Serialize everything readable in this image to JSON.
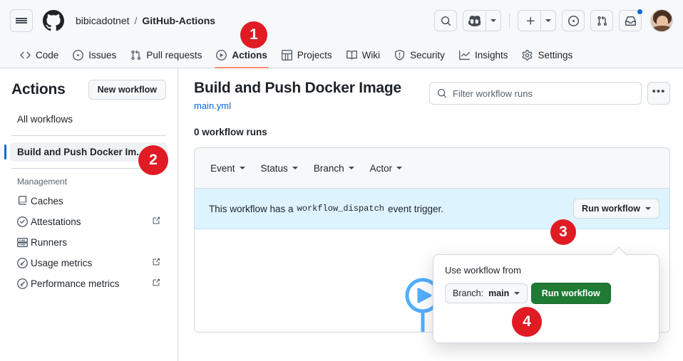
{
  "header": {
    "menu_icon": "hamburger-icon",
    "logo_icon": "github-logo-icon",
    "owner": "bibicadotnet",
    "separator": "/",
    "repo": "GitHub-Actions",
    "actions": [
      {
        "name": "search-button",
        "icon": "search-icon"
      },
      {
        "name": "copilot-button",
        "icon": "copilot-icon"
      },
      {
        "name": "copilot-caret",
        "icon": "chevron-down-icon"
      },
      {
        "name": "create-new-button",
        "icon": "plus-icon"
      },
      {
        "name": "create-new-caret",
        "icon": "chevron-down-icon"
      },
      {
        "name": "issues-button",
        "icon": "issue-opened-icon"
      },
      {
        "name": "pull-requests-button",
        "icon": "git-pull-request-icon"
      },
      {
        "name": "notifications-button",
        "icon": "inbox-icon"
      },
      {
        "name": "avatar-button",
        "icon": "avatar"
      }
    ]
  },
  "repo_nav": {
    "tabs": [
      {
        "label": "Code",
        "icon": "code-icon",
        "active": false
      },
      {
        "label": "Issues",
        "icon": "issue-opened-icon",
        "active": false
      },
      {
        "label": "Pull requests",
        "icon": "git-pull-request-icon",
        "active": false
      },
      {
        "label": "Actions",
        "icon": "play-circle-icon",
        "active": true
      },
      {
        "label": "Projects",
        "icon": "table-icon",
        "active": false
      },
      {
        "label": "Wiki",
        "icon": "book-icon",
        "active": false
      },
      {
        "label": "Security",
        "icon": "shield-icon",
        "active": false
      },
      {
        "label": "Insights",
        "icon": "graph-icon",
        "active": false
      },
      {
        "label": "Settings",
        "icon": "gear-icon",
        "active": false
      }
    ]
  },
  "sidebar": {
    "title": "Actions",
    "new_workflow_label": "New workflow",
    "all_workflows_label": "All workflows",
    "selected_workflow": "Build and Push Docker Im..",
    "management_title": "Management",
    "management_items": [
      {
        "label": "Caches",
        "icon": "cache-icon",
        "external": false
      },
      {
        "label": "Attestations",
        "icon": "verified-check-icon",
        "external": true
      },
      {
        "label": "Runners",
        "icon": "server-icon",
        "external": false
      },
      {
        "label": "Usage metrics",
        "icon": "meter-icon",
        "external": true
      },
      {
        "label": "Performance metrics",
        "icon": "meter-icon",
        "external": true
      }
    ]
  },
  "main": {
    "workflow_title": "Build and Push Docker Image",
    "workflow_file": "main.yml",
    "filter_placeholder": "Filter workflow runs",
    "filter_value": "",
    "search_icon": "search-icon",
    "kebab_label": "•••",
    "runs_count": "0 workflow runs",
    "filters": [
      {
        "label": "Event",
        "icon": "chevron-down-icon"
      },
      {
        "label": "Status",
        "icon": "chevron-down-icon"
      },
      {
        "label": "Branch",
        "icon": "chevron-down-icon"
      },
      {
        "label": "Actor",
        "icon": "chevron-down-icon"
      }
    ],
    "dispatch_banner": {
      "text_before": "This workflow has a",
      "code": "workflow_dispatch",
      "text_after": "event trigger.",
      "run_button_label": "Run workflow"
    }
  },
  "dropdown": {
    "label": "Use workflow from",
    "branch_prefix": "Branch:",
    "branch_name": "main",
    "run_button_label": "Run workflow"
  },
  "step_badges": [
    {
      "number": "1"
    },
    {
      "number": "2"
    },
    {
      "number": "3"
    },
    {
      "number": "4"
    }
  ],
  "colors": {
    "badge_red": "#e01b24",
    "accent_blue": "#0969da",
    "banner_blue": "#ddf4ff",
    "green_button": "#1f7a34",
    "active_tab_underline": "#fd8c73",
    "header_bg": "#f6f8fa",
    "border": "#d1d9e0",
    "illustration_blue": "#54aeff"
  }
}
